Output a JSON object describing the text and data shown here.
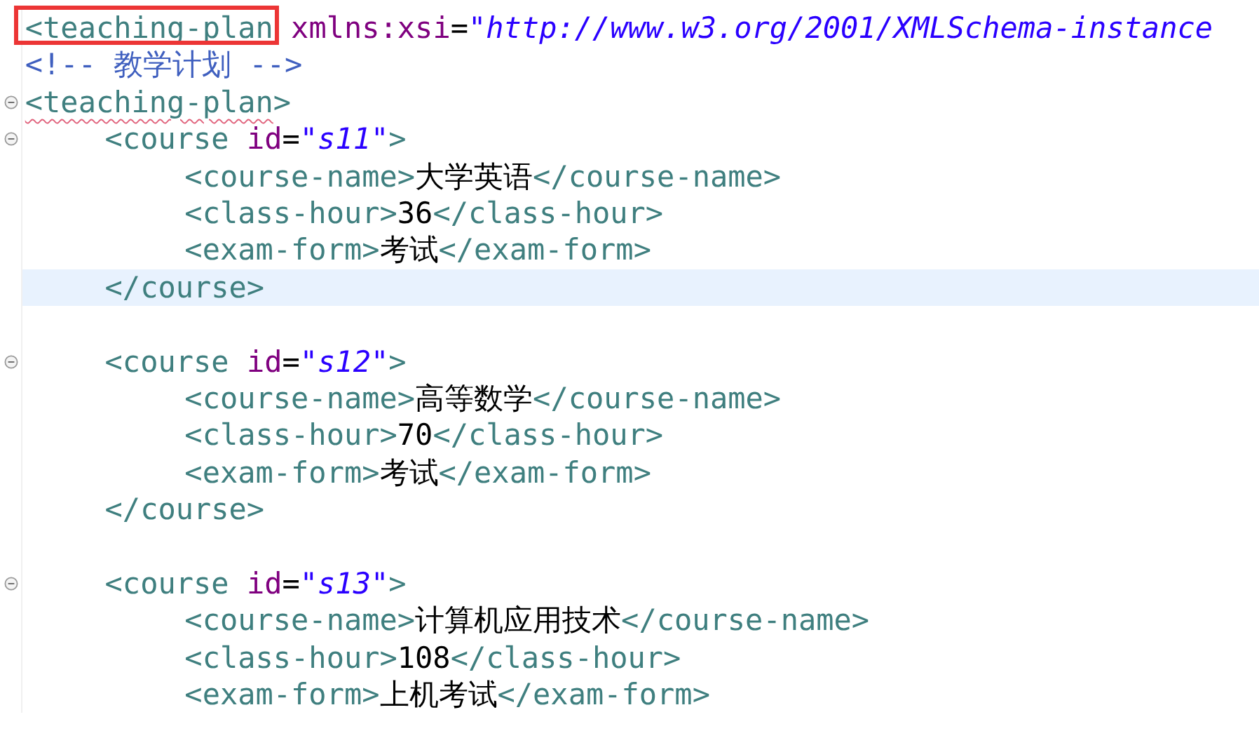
{
  "editor": {
    "lines": [
      {
        "kind": "code",
        "foldable": false,
        "current": false,
        "segments": [
          {
            "kind": "tag",
            "text": "<teaching-plan",
            "boxed": true
          },
          {
            "kind": "attr",
            "text": " xmlns:xsi"
          },
          {
            "kind": "text",
            "text": "="
          },
          {
            "kind": "value",
            "text": "\"http://www.w3.org/2001/XMLSchema-instance"
          }
        ]
      },
      {
        "kind": "code",
        "foldable": false,
        "current": false,
        "segments": [
          {
            "kind": "comment",
            "text": "<!-- 教学计划 -->"
          }
        ]
      },
      {
        "kind": "code",
        "foldable": true,
        "current": false,
        "segments": [
          {
            "kind": "tag",
            "text": "<teaching-plan",
            "misspelled": true
          },
          {
            "kind": "tag",
            "text": ">"
          }
        ],
        "children": [
          {
            "kind": "code",
            "foldable": true,
            "current": false,
            "segments": [
              {
                "kind": "tag",
                "text": "<course"
              },
              {
                "kind": "attr",
                "text": " id"
              },
              {
                "kind": "text",
                "text": "="
              },
              {
                "kind": "value",
                "text": "\"s11\""
              },
              {
                "kind": "tag",
                "text": ">"
              }
            ],
            "children": [
              {
                "kind": "code",
                "foldable": false,
                "current": false,
                "segments": [
                  {
                    "kind": "tag",
                    "text": "<course-name>"
                  },
                  {
                    "kind": "text",
                    "text": "大学英语"
                  },
                  {
                    "kind": "tag",
                    "text": "</course-name>"
                  }
                ]
              },
              {
                "kind": "code",
                "foldable": false,
                "current": false,
                "segments": [
                  {
                    "kind": "tag",
                    "text": "<class-hour>"
                  },
                  {
                    "kind": "text",
                    "text": "36"
                  },
                  {
                    "kind": "tag",
                    "text": "</class-hour>"
                  }
                ]
              },
              {
                "kind": "code",
                "foldable": false,
                "current": false,
                "segments": [
                  {
                    "kind": "tag",
                    "text": "<exam-form>"
                  },
                  {
                    "kind": "text",
                    "text": "考试"
                  },
                  {
                    "kind": "tag",
                    "text": "</exam-form>"
                  }
                ]
              }
            ]
          },
          {
            "kind": "code",
            "foldable": false,
            "current": true,
            "segments": [
              {
                "kind": "tag",
                "text": "</course>"
              }
            ]
          },
          {
            "kind": "blank"
          },
          {
            "kind": "code",
            "foldable": true,
            "current": false,
            "segments": [
              {
                "kind": "tag",
                "text": "<course"
              },
              {
                "kind": "attr",
                "text": " id"
              },
              {
                "kind": "text",
                "text": "="
              },
              {
                "kind": "value",
                "text": "\"s12\""
              },
              {
                "kind": "tag",
                "text": ">"
              }
            ],
            "children": [
              {
                "kind": "code",
                "foldable": false,
                "current": false,
                "segments": [
                  {
                    "kind": "tag",
                    "text": "<course-name>"
                  },
                  {
                    "kind": "text",
                    "text": "高等数学"
                  },
                  {
                    "kind": "tag",
                    "text": "</course-name>"
                  }
                ]
              },
              {
                "kind": "code",
                "foldable": false,
                "current": false,
                "segments": [
                  {
                    "kind": "tag",
                    "text": "<class-hour>"
                  },
                  {
                    "kind": "text",
                    "text": "70"
                  },
                  {
                    "kind": "tag",
                    "text": "</class-hour>"
                  }
                ]
              },
              {
                "kind": "code",
                "foldable": false,
                "current": false,
                "segments": [
                  {
                    "kind": "tag",
                    "text": "<exam-form>"
                  },
                  {
                    "kind": "text",
                    "text": "考试"
                  },
                  {
                    "kind": "tag",
                    "text": "</exam-form>"
                  }
                ]
              }
            ]
          },
          {
            "kind": "code",
            "foldable": false,
            "current": false,
            "segments": [
              {
                "kind": "tag",
                "text": "</course>"
              }
            ]
          },
          {
            "kind": "blank"
          },
          {
            "kind": "code",
            "foldable": true,
            "current": false,
            "segments": [
              {
                "kind": "tag",
                "text": "<course"
              },
              {
                "kind": "attr",
                "text": " id"
              },
              {
                "kind": "text",
                "text": "="
              },
              {
                "kind": "value",
                "text": "\"s13\""
              },
              {
                "kind": "tag",
                "text": ">"
              }
            ],
            "children": [
              {
                "kind": "code",
                "foldable": false,
                "current": false,
                "segments": [
                  {
                    "kind": "tag",
                    "text": "<course-name>"
                  },
                  {
                    "kind": "text",
                    "text": "计算机应用技术"
                  },
                  {
                    "kind": "tag",
                    "text": "</course-name>"
                  }
                ]
              },
              {
                "kind": "code",
                "foldable": false,
                "current": false,
                "segments": [
                  {
                    "kind": "tag",
                    "text": "<class-hour>"
                  },
                  {
                    "kind": "text",
                    "text": "108"
                  },
                  {
                    "kind": "tag",
                    "text": "</class-hour>"
                  }
                ]
              },
              {
                "kind": "code",
                "foldable": false,
                "current": false,
                "segments": [
                  {
                    "kind": "tag",
                    "text": "<exam-form>"
                  },
                  {
                    "kind": "text",
                    "text": "上机考试"
                  },
                  {
                    "kind": "tag",
                    "text": "</exam-form>"
                  }
                ]
              }
            ]
          }
        ]
      }
    ]
  }
}
